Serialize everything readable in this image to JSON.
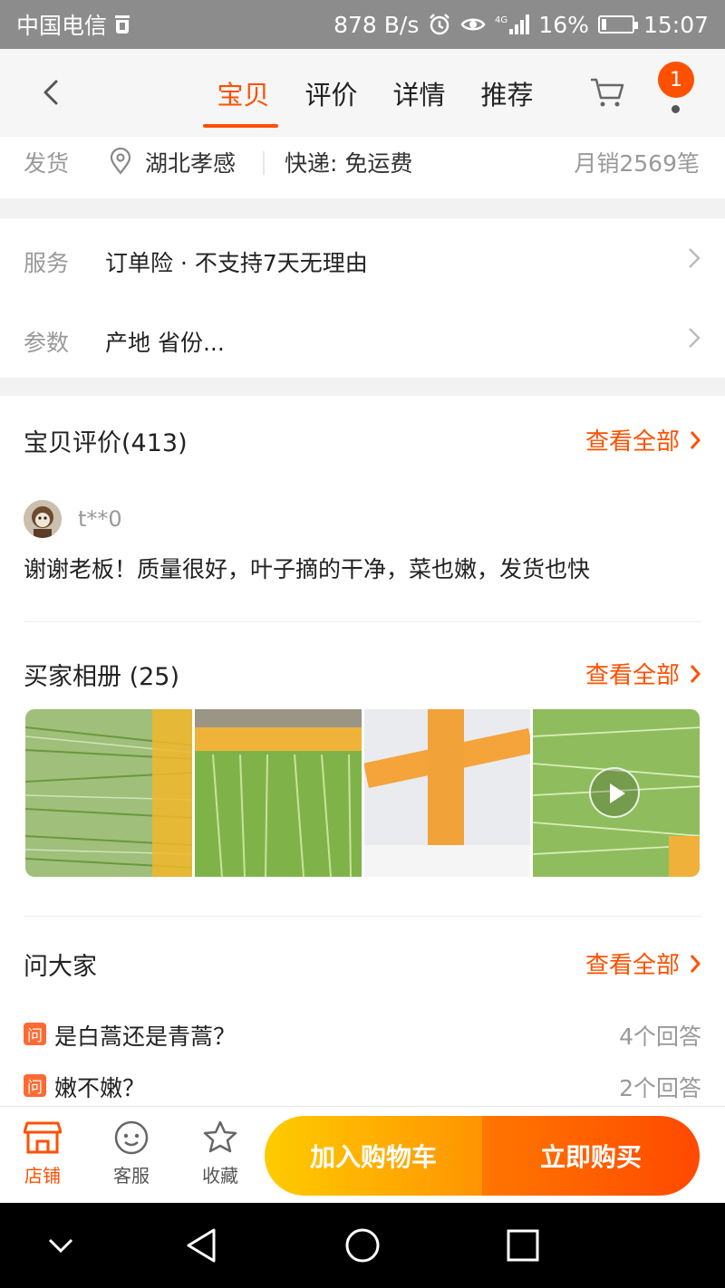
{
  "status_bar": {
    "carrier": "中国电信",
    "net_speed": "878 B/s",
    "battery": "16%",
    "battery_level": 0.16,
    "time": "15:07"
  },
  "nav": {
    "tabs": [
      {
        "label": "宝贝",
        "active": true
      },
      {
        "label": "评价",
        "active": false
      },
      {
        "label": "详情",
        "active": false
      },
      {
        "label": "推荐",
        "active": false
      }
    ],
    "cart_badge": "1"
  },
  "shipping": {
    "label": "发货",
    "location": "湖北孝感",
    "express": "快递: 免运费",
    "monthly_sales": "月销2569笔"
  },
  "service": {
    "service_label": "服务",
    "service_value": "订单险 · 不支持7天无理由",
    "params_label": "参数",
    "params_value": "产地 省份..."
  },
  "reviews": {
    "title": "宝贝评价(413)",
    "view_all": "查看全部",
    "user": "t**0",
    "text": "谢谢老板！质量很好，叶子摘的干净，菜也嫩，发货也快"
  },
  "album": {
    "title": "买家相册 (25)",
    "view_all": "查看全部"
  },
  "qa": {
    "title": "问大家",
    "view_all": "查看全部",
    "badge": "问",
    "items": [
      {
        "question": "是白蒿还是青蒿？",
        "answers": "4个回答"
      },
      {
        "question": "嫩不嫩？",
        "answers": "2个回答"
      }
    ]
  },
  "action_bar": {
    "store": "店铺",
    "service": "客服",
    "favorite": "收藏",
    "add_to_cart": "加入购物车",
    "buy_now": "立即购买"
  },
  "colors": {
    "accent": "#ff5000",
    "cart_button": "#ffa000",
    "buy_button": "#ff5500"
  }
}
